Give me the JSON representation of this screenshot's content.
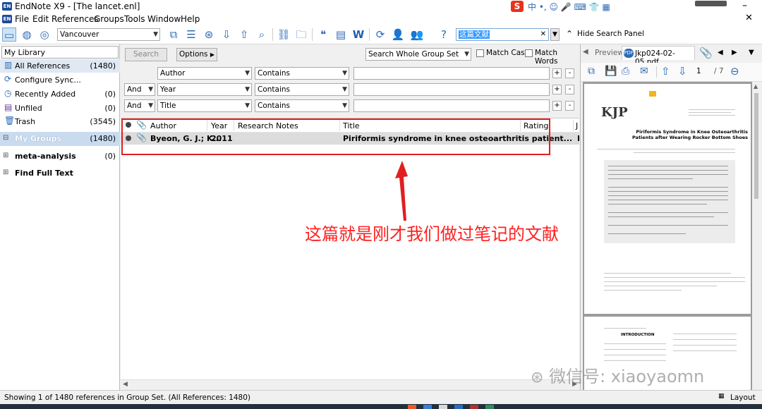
{
  "window": {
    "app_icon_text": "EN",
    "title": "EndNote X9 - [The lancet.enl]"
  },
  "menu": [
    "File",
    "Edit",
    "References",
    "Groups",
    "Tools",
    "Window",
    "Help"
  ],
  "toolbar": {
    "style": "Vancouver",
    "quick_search_value": "这篇文献",
    "hide_search_label": "Hide Search Panel"
  },
  "library": {
    "header": "My Library",
    "items": [
      {
        "label": "All References",
        "count": "(1480)",
        "icon": "books-icon"
      },
      {
        "label": "Configure Sync...",
        "count": "",
        "icon": "sync-icon"
      },
      {
        "label": "Recently Added",
        "count": "(0)",
        "icon": "clock-icon"
      },
      {
        "label": "Unfiled",
        "count": "(0)",
        "icon": "unfiled-icon"
      },
      {
        "label": "Trash",
        "count": "(3545)",
        "icon": "trash-icon"
      }
    ],
    "groups_header": "My Groups",
    "groups_count": "(1480)",
    "groups": [
      {
        "label": "meta-analysis",
        "count": "(0)"
      },
      {
        "label": "Find Full Text",
        "count": ""
      }
    ]
  },
  "search": {
    "search_button": "Search",
    "options_button": "Options",
    "scope": "Search Whole Group Set",
    "match_case": "Match Case",
    "match_words": "Match Words",
    "rows": [
      {
        "bool": "",
        "field": "Author",
        "op": "Contains",
        "value": ""
      },
      {
        "bool": "And",
        "field": "Year",
        "op": "Contains",
        "value": ""
      },
      {
        "bool": "And",
        "field": "Title",
        "op": "Contains",
        "value": ""
      }
    ],
    "plus": "+",
    "minus": "-"
  },
  "table": {
    "columns": [
      "Author",
      "Year",
      "Research Notes",
      "Title",
      "Rating",
      "J"
    ],
    "rows": [
      {
        "author": "Byeon, G. J.; K...",
        "year": "2011",
        "notes": "",
        "title": "Piriformis syndrome in knee osteoarthritis patient...",
        "rating": "",
        "j": "I"
      }
    ]
  },
  "annotation": "这篇就是刚才我们做过笔记的文献",
  "preview": {
    "tab_label": "Preview",
    "pdf_tab": "Jkp024-02-05.pdf",
    "page_current": "1",
    "page_total": "/ 7",
    "journal_logo": "KJP",
    "paper_title": "Piriformis Syndrome in Knee Osteoarthritis Patients after Wearing Rocker Bottom Shoes",
    "page2_heading": "INTRODUCTION"
  },
  "status": {
    "text": "Showing 1 of 1480 references in Group Set. (All References: 1480)",
    "layout": "Layout"
  },
  "watermark": "微信号: xiaoyaomn",
  "colors": {
    "accent": "#2c6bb5",
    "annotation": "#ff2020",
    "selection": "#dcdcdc"
  }
}
